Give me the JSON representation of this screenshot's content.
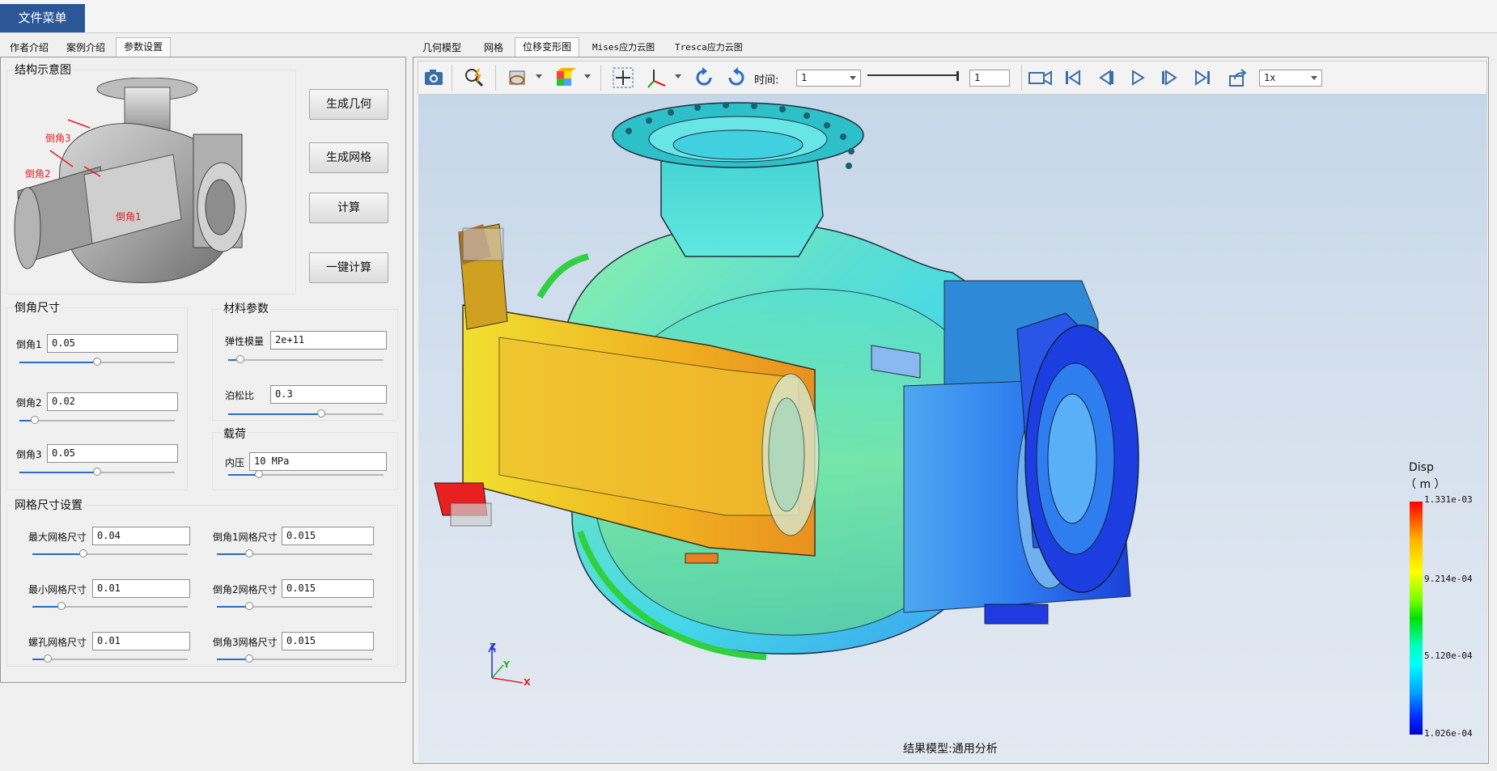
{
  "menubar": {
    "file_menu": "文件菜单"
  },
  "left_tabs": [
    "作者介绍",
    "案例介绍",
    "参数设置"
  ],
  "structure": {
    "title": "结构示意图",
    "callouts": [
      "倒角3",
      "倒角2",
      "倒角1"
    ],
    "buttons": [
      "生成几何",
      "生成网格",
      "计算",
      "一键计算"
    ]
  },
  "chamfer": {
    "title": "倒角尺寸",
    "fields": [
      {
        "label": "倒角1",
        "value": "0.05",
        "slider": 0.5
      },
      {
        "label": "倒角2",
        "value": "0.02",
        "slider": 0.1
      },
      {
        "label": "倒角3",
        "value": "0.05",
        "slider": 0.5
      }
    ]
  },
  "material": {
    "title": "材料参数",
    "fields": [
      {
        "label": "弹性模量",
        "value": "2e+11",
        "slider": 0.08
      },
      {
        "label": "泊松比",
        "value": "0.3",
        "slider": 0.6
      }
    ]
  },
  "load": {
    "title": "载荷",
    "fields": [
      {
        "label": "内压",
        "value": "10 MPa",
        "slider": 0.2
      }
    ]
  },
  "mesh": {
    "title": "网格尺寸设置",
    "left": [
      {
        "label": "最大网格尺寸",
        "value": "0.04",
        "slider": 0.33
      },
      {
        "label": "最小网格尺寸",
        "value": "0.01",
        "slider": 0.19
      },
      {
        "label": "螺孔网格尺寸",
        "value": "0.01",
        "slider": 0.1
      }
    ],
    "right": [
      {
        "label": "倒角1网格尺寸",
        "value": "0.015",
        "slider": 0.21
      },
      {
        "label": "倒角2网格尺寸",
        "value": "0.015",
        "slider": 0.21
      },
      {
        "label": "倒角3网格尺寸",
        "value": "0.015",
        "slider": 0.21
      }
    ]
  },
  "right_tabs": [
    "几何模型",
    "网格",
    "位移变形图",
    "Mises应力云图",
    "Tresca应力云图"
  ],
  "toolbar": {
    "time_label": "时间:",
    "time_value": "1",
    "frame_value": "1",
    "speed_value": "1x",
    "time_slider": 1.0
  },
  "legend": {
    "title": "Disp",
    "unit": "（ m ）",
    "ticks": [
      "1.331e-03",
      "9.214e-04",
      "5.120e-04",
      "1.026e-04"
    ],
    "colors": [
      "#ff0000",
      "#ffff00",
      "#00e000",
      "#00ffff",
      "#0000d0"
    ]
  },
  "axes": {
    "z": "Z",
    "y": "Y",
    "x": "X"
  },
  "status": "结果模型:通用分析"
}
